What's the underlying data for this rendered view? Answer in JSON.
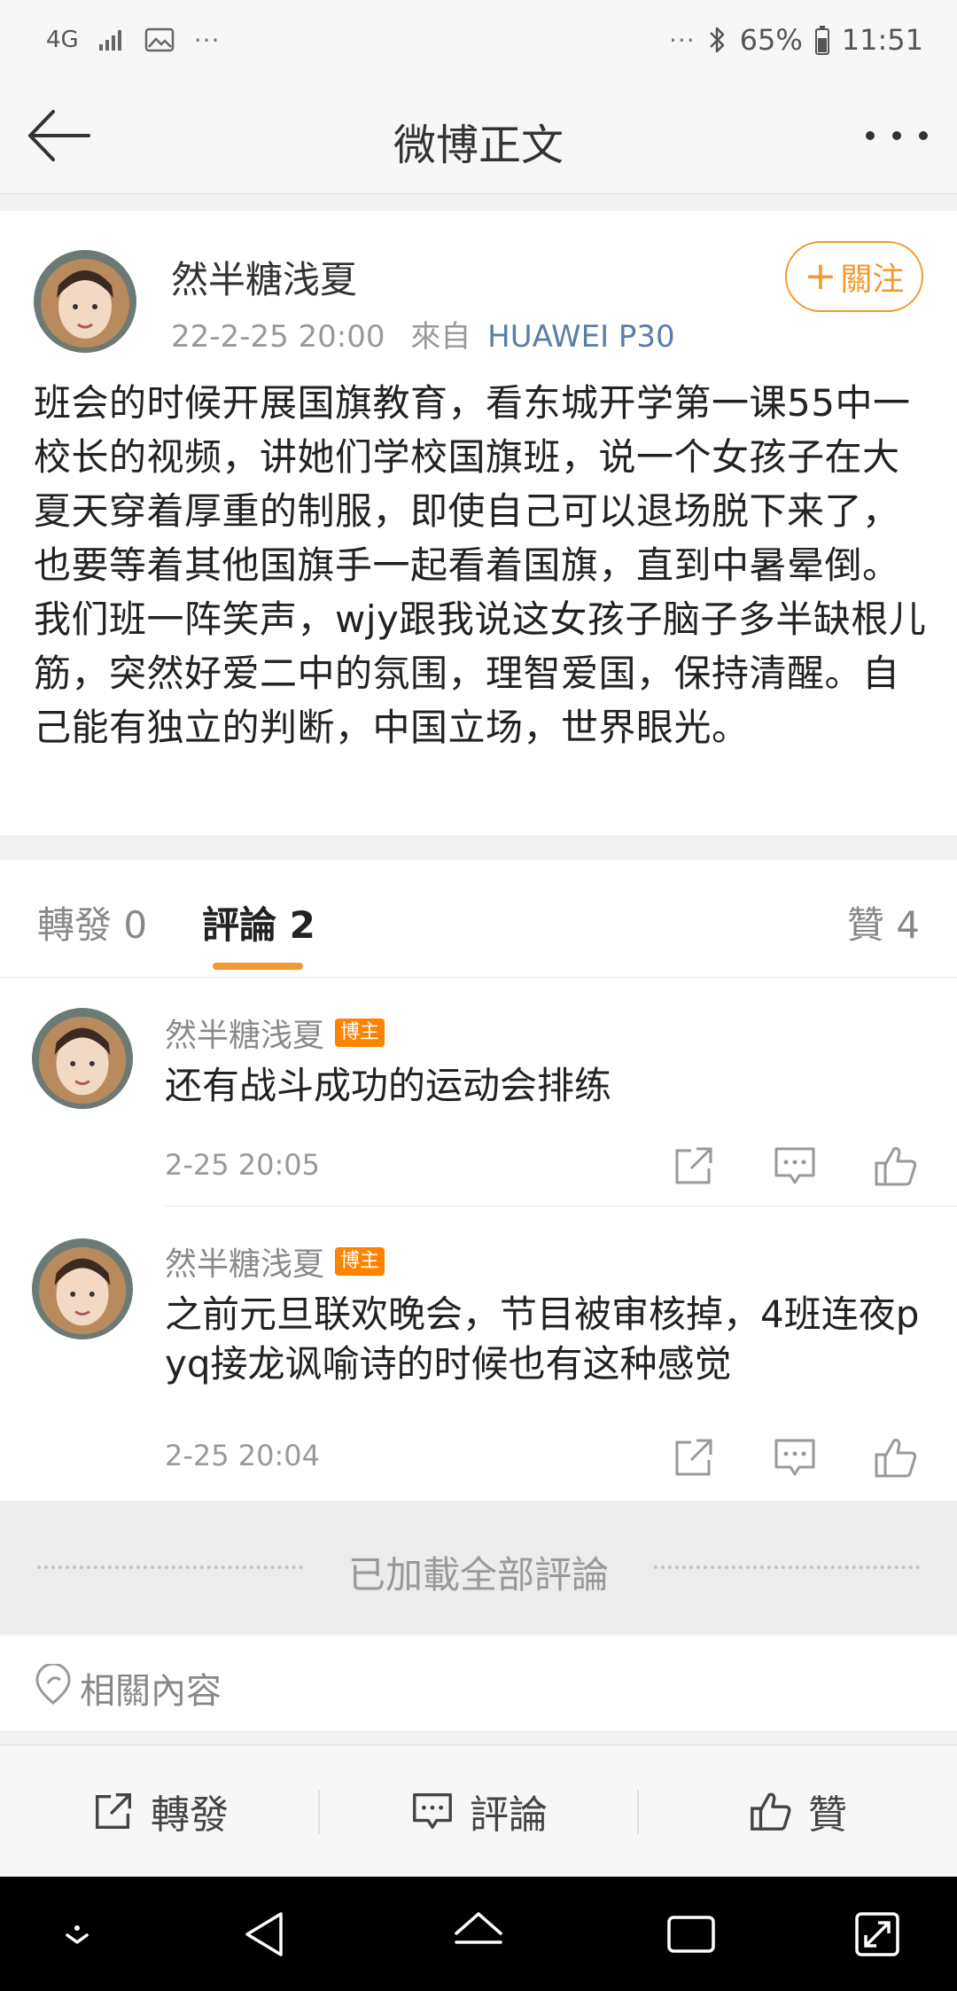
{
  "status_bar": {
    "network": "4G",
    "more": "···",
    "left_more": "···",
    "battery": "65%",
    "time": "11:51"
  },
  "header": {
    "title": "微博正文"
  },
  "post": {
    "author": "然半糖浅夏",
    "date": "22-2-25 20:00",
    "source_prefix": "來自",
    "device": "HUAWEI P30",
    "follow_label": "關注",
    "text": "班会的时候开展国旗教育，看东城开学第一课55中一校长的视频，讲她们学校国旗班，说一个女孩子在大夏天穿着厚重的制服，即使自己可以退场脱下来了，也要等着其他国旗手一起看着国旗，直到中暑晕倒。我们班一阵笑声，wjy跟我说这女孩子脑子多半缺根儿筋，突然好爱二中的氛围，理智爱国，保持清醒。自己能有独立的判断，中国立场，世界眼光。"
  },
  "tabs": {
    "repost": "轉發 0",
    "comment": "評論 2",
    "like": "贊 4"
  },
  "comments": [
    {
      "name": "然半糖浅夏",
      "badge": "博主",
      "text": "还有战斗成功的运动会排练",
      "time": "2-25 20:05"
    },
    {
      "name": "然半糖浅夏",
      "badge": "博主",
      "text": "之前元旦联欢晚会，节目被审核掉，4班连夜pyq接龙讽喻诗的时候也有这种感觉",
      "time": "2-25 20:04"
    }
  ],
  "loaded_all": "已加載全部評論",
  "related": "相關內容",
  "toolbar": {
    "repost": "轉發",
    "comment": "評論",
    "like": "贊"
  },
  "colors": {
    "accent": "#f09a2f",
    "badge": "#ff8200",
    "device_link": "#5a7ea8"
  }
}
